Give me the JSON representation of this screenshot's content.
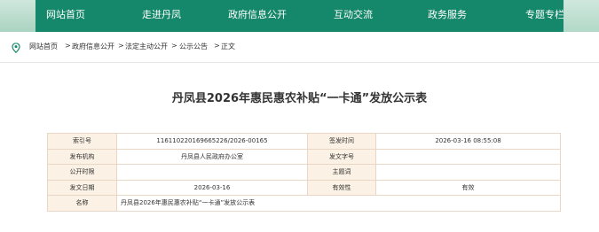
{
  "nav": {
    "items": [
      {
        "label": "网站首页"
      },
      {
        "label": "走进丹凤"
      },
      {
        "label": "政府信息公开"
      },
      {
        "label": "互动交流"
      },
      {
        "label": "政务服务"
      },
      {
        "label": "专题专栏"
      }
    ]
  },
  "breadcrumb": {
    "items": [
      "网站首页",
      "政府信息公开",
      "法定主动公开",
      "公示公告",
      "正文"
    ],
    "separator": ">"
  },
  "article": {
    "title": "丹凤县2026年惠民惠农补贴“一卡通”发放公示表"
  },
  "meta_table": {
    "rows": [
      {
        "k1": "索引号",
        "v1": "116110220169665226/2026-00165",
        "k2": "签发时间",
        "v2": "2026-03-16 08:55:08"
      },
      {
        "k1": "发布机构",
        "v1": "丹凤县人民政府办公室",
        "k2": "发文字号",
        "v2": ""
      },
      {
        "k1": "公开时限",
        "v1": "",
        "k2": "主题词",
        "v2": ""
      },
      {
        "k1": "发文日期",
        "v1": "2026-03-16",
        "k2": "有效性",
        "v2": "有效"
      }
    ],
    "name_row": {
      "k": "名称",
      "v": "丹凤县2026年惠民惠农补贴“一卡通”发放公示表"
    }
  },
  "colors": {
    "nav_bg": "#15876a",
    "table_border": "#ead6c4",
    "table_key_bg": "#fbf1e4"
  }
}
